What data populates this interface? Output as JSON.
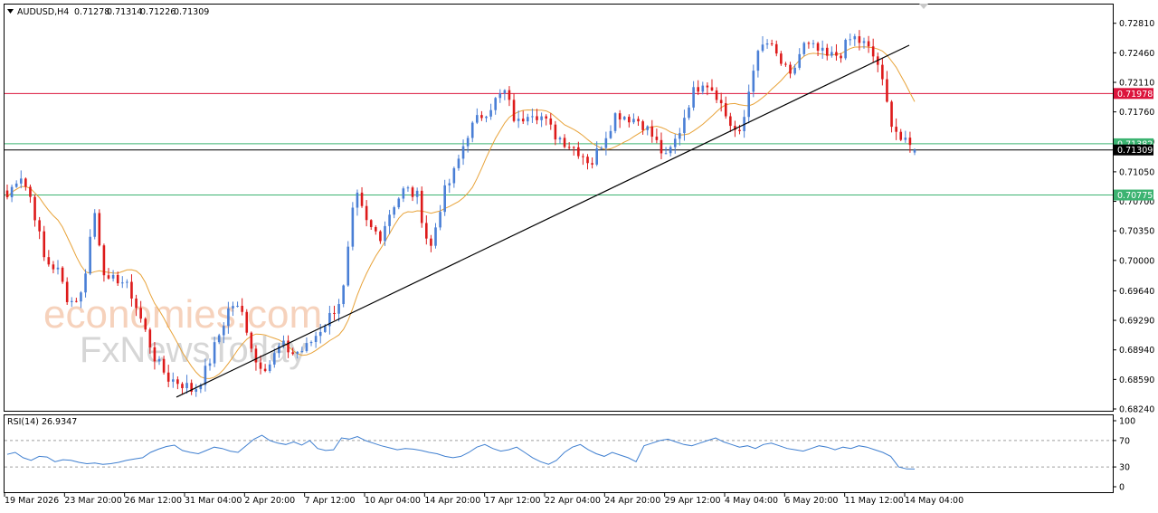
{
  "chart_data": {
    "type": "candlestick",
    "symbol": "AUDUSD,H4",
    "ohlc_header": {
      "open": "0.71278",
      "high": "0.71314",
      "low": "0.71226",
      "close": "0.71309"
    },
    "price_axis": {
      "min": 0.6824,
      "max": 0.7285,
      "ticks": [
        "0.72810",
        "0.72460",
        "0.72110",
        "0.71760",
        "0.71410",
        "0.71050",
        "0.70700",
        "0.70350",
        "0.70000",
        "0.69640",
        "0.69290",
        "0.68940",
        "0.68590",
        "0.68240"
      ]
    },
    "time_axis": [
      "19 Mar 2026",
      "23 Mar 20:00",
      "26 Mar 12:00",
      "31 Mar 04:00",
      "2 Apr 20:00",
      "7 Apr 12:00",
      "10 Apr 04:00",
      "14 Apr 20:00",
      "17 Apr 12:00",
      "22 Apr 04:00",
      "24 Apr 20:00",
      "29 Apr 12:00",
      "4 May 04:00",
      "6 May 20:00",
      "11 May 12:00",
      "14 May 04:00"
    ],
    "horizontal_levels": [
      {
        "price": 0.71978,
        "label": "0.71978",
        "color": "#dc143c"
      },
      {
        "price": 0.71382,
        "label": "0.71382",
        "color": "#3cb371"
      },
      {
        "price": 0.71309,
        "label": "0.71309",
        "color": "#000000"
      },
      {
        "price": 0.70775,
        "label": "0.70775",
        "color": "#3cb371"
      }
    ],
    "trendline": {
      "from_price": 0.6838,
      "to_price": 0.7255,
      "color": "#000000"
    },
    "moving_average_color": "#e8a33a",
    "bull_color": "#4a7fd6",
    "bear_color": "#dd1a1a",
    "close_path": [
      0.7075,
      0.7105,
      0.707,
      0.7,
      0.699,
      0.695,
      0.696,
      0.706,
      0.697,
      0.698,
      0.696,
      0.692,
      0.688,
      0.686,
      0.6855,
      0.6845,
      0.687,
      0.691,
      0.695,
      0.6935,
      0.688,
      0.6875,
      0.69,
      0.689,
      0.6895,
      0.6915,
      0.6935,
      0.696,
      0.708,
      0.704,
      0.703,
      0.7065,
      0.7085,
      0.7075,
      0.701,
      0.7075,
      0.7105,
      0.715,
      0.717,
      0.7185,
      0.72,
      0.716,
      0.718,
      0.717,
      0.715,
      0.714,
      0.713,
      0.7115,
      0.7145,
      0.7175,
      0.717,
      0.7165,
      0.7145,
      0.712,
      0.715,
      0.7195,
      0.7215,
      0.72,
      0.7165,
      0.7145,
      0.723,
      0.726,
      0.724,
      0.7215,
      0.7255,
      0.725,
      0.724,
      0.7245,
      0.7265,
      0.7255,
      0.7235,
      0.717,
      0.714,
      0.7131
    ],
    "rsi": {
      "label": "RSI(14) 26.9347",
      "levels": [
        "100",
        "70",
        "30",
        "0"
      ],
      "level_values": [
        100,
        70,
        30,
        0
      ],
      "color": "#3f7fd0",
      "values": [
        49,
        52,
        44,
        40,
        46,
        45,
        38,
        41,
        40,
        37,
        35,
        36,
        34,
        35,
        37,
        40,
        42,
        44,
        52,
        57,
        61,
        63,
        55,
        52,
        50,
        55,
        60,
        58,
        54,
        52,
        62,
        72,
        78,
        70,
        66,
        64,
        68,
        63,
        70,
        58,
        55,
        56,
        74,
        72,
        76,
        70,
        66,
        62,
        59,
        56,
        58,
        57,
        55,
        52,
        50,
        46,
        44,
        46,
        52,
        60,
        64,
        58,
        54,
        56,
        60,
        52,
        44,
        38,
        34,
        40,
        52,
        60,
        64,
        56,
        50,
        46,
        52,
        48,
        44,
        38,
        62,
        66,
        70,
        72,
        68,
        64,
        62,
        66,
        70,
        74,
        68,
        64,
        60,
        62,
        58,
        64,
        66,
        62,
        58,
        56,
        54,
        58,
        62,
        60,
        56,
        60,
        58,
        62,
        60,
        56,
        52,
        46,
        30,
        27,
        26.9
      ]
    }
  },
  "watermark": {
    "line1": "economies.com",
    "line2": "FxNewsToday"
  }
}
